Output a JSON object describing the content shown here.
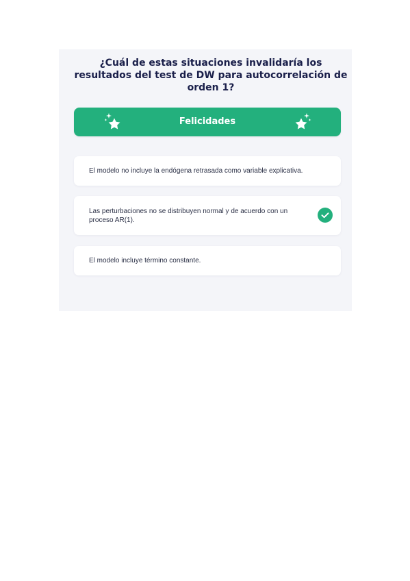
{
  "quiz": {
    "question": "¿Cuál de estas situaciones invalidaría los resultados del test de DW para autocorrelación de orden 1?",
    "banner": {
      "title": "Felicidades",
      "left_icon": "sparkle-star-icon",
      "right_icon": "sparkle-star-icon",
      "color": "#23b07d"
    },
    "options": [
      {
        "text": "El modelo no incluye la endógena retrasada como variable explicativa.",
        "selected": false
      },
      {
        "text": "Las perturbaciones no se distribuyen normal y de acuerdo con un proceso AR(1).",
        "selected": true,
        "icon": "check-circle-icon"
      },
      {
        "text": "El modelo incluye término constante.",
        "selected": false
      }
    ]
  }
}
